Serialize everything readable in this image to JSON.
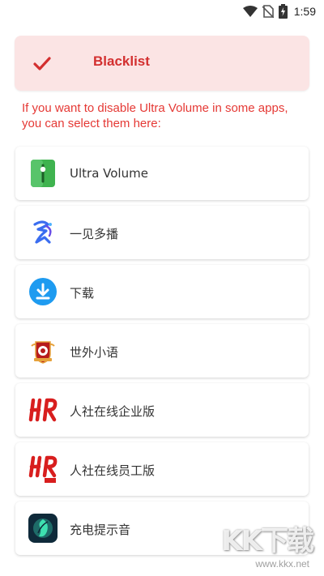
{
  "status_bar": {
    "time": "1:59",
    "icons": [
      "wifi-icon",
      "no-sim-icon",
      "battery-charging-icon"
    ]
  },
  "banner": {
    "icon": "check-icon",
    "title": "Blacklist",
    "background": "#fbe4e4",
    "accent": "#d32f2f"
  },
  "info": {
    "text": "If you want to disable Ultra Volume in some apps, you can select them here:"
  },
  "apps": [
    {
      "name": "Ultra Volume",
      "icon": "ultra-volume-icon"
    },
    {
      "name": "一见多播",
      "icon": "yijian-duobo-icon"
    },
    {
      "name": "下载",
      "icon": "download-icon"
    },
    {
      "name": "世外小语",
      "icon": "shiwai-xiaoyu-icon"
    },
    {
      "name": "人社在线企业版",
      "icon": "hr-enterprise-icon"
    },
    {
      "name": "人社在线员工版",
      "icon": "hr-employee-icon"
    },
    {
      "name": "充电提示音",
      "icon": "charging-sound-icon"
    }
  ],
  "watermark": {
    "brand": "KK下载",
    "url": "www.kkx.net"
  }
}
